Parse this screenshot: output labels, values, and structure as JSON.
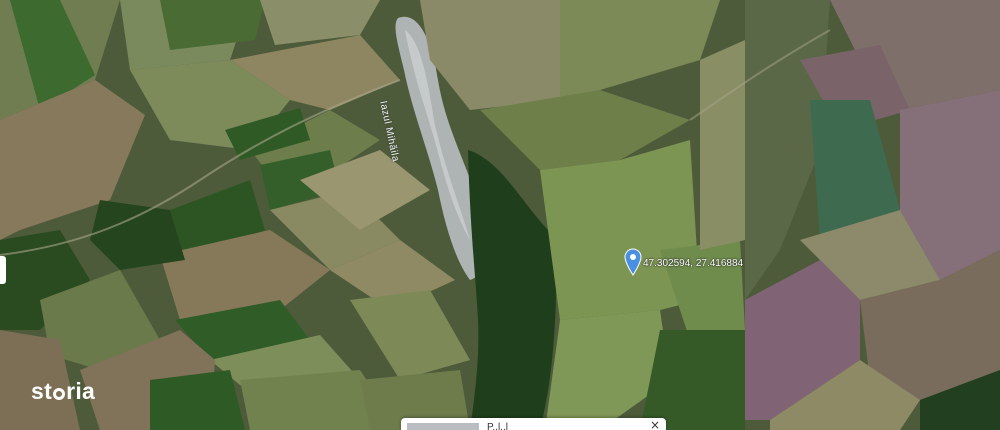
{
  "map": {
    "lake_label": "Iazul Mihăila",
    "marker": {
      "coordinates_label": "47.302594, 27.416884",
      "pin_color": "#4a90e2"
    },
    "brand": {
      "logo_text_before": "st",
      "logo_text_after": "ria"
    },
    "popup": {
      "title": "P..l..l",
      "close_symbol": "×"
    }
  }
}
